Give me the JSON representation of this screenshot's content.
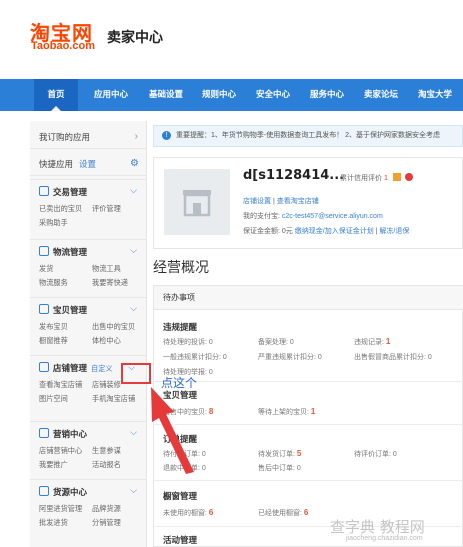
{
  "header": {
    "logo_cn": "淘宝网",
    "logo_en": "Taobao.com",
    "subtitle": "卖家中心"
  },
  "nav": {
    "items": [
      "首页",
      "应用中心",
      "基础设置",
      "规则中心",
      "安全中心",
      "服务中心",
      "卖家论坛",
      "淘宝大学"
    ],
    "active": 0
  },
  "sidebar": {
    "ordered_apps": "我订购的应用",
    "quick_apps": "快捷应用",
    "quick_settings": "设置",
    "groups": [
      {
        "title": "交易管理",
        "links": [
          "已卖出的宝贝",
          "评价管理",
          "采购助手"
        ]
      },
      {
        "title": "物流管理",
        "links": [
          "发货",
          "物流工具",
          "物流服务",
          "我要寄快递"
        ]
      },
      {
        "title": "宝贝管理",
        "links": [
          "发布宝贝",
          "出售中的宝贝",
          "橱窗推荐",
          "体检中心"
        ]
      },
      {
        "title": "店铺管理",
        "custom": "自定义",
        "links": [
          "查看淘宝店铺",
          "店铺装修",
          "图片空间",
          "手机淘宝店铺"
        ]
      },
      {
        "title": "营销中心",
        "links": [
          "店铺营销中心",
          "我要推广",
          "生意参谋",
          "活动报名"
        ]
      },
      {
        "title": "货源中心",
        "links": [
          "阿里进货管理",
          "品牌货源",
          "批发进货",
          "分销管理"
        ]
      }
    ]
  },
  "annotation": "点这个",
  "notice": "重要提醒：1、年货节购物季-使用数据查询工具发布！ 2、基于保护网家数据安全考虑",
  "shop": {
    "name": "d[s1128414...",
    "credit_label": "累计信用评价",
    "credit_value": "1",
    "link_settings": "店铺设置",
    "link_view": "查看淘宝店铺",
    "alipay_label": "我的支付宝:",
    "alipay_value": "c2c-test457@service.aliyun.com",
    "deposit_label": "保证金金额: 0元",
    "deposit_links": "缴纳现金/加入保证金计划",
    "deposit_more": "解冻/退保"
  },
  "overview_title": "经营概况",
  "todo": {
    "header": "待办事项",
    "sections": [
      {
        "title": "违规提醒",
        "cells": [
          {
            "label": "待处理的投诉:",
            "value": "0"
          },
          {
            "label": "备案处理:",
            "value": "0"
          },
          {
            "label": "违规记录:",
            "value": "1"
          },
          {
            "label": "一般违规累计扣分:",
            "value": "0"
          },
          {
            "label": "严重违规累计扣分:",
            "value": "0"
          },
          {
            "label": "出售假冒商品累计扣分:",
            "value": "0"
          },
          {
            "label": "待处理的举报:",
            "value": "0"
          }
        ]
      },
      {
        "title": "宝贝管理",
        "cells": [
          {
            "label": "出售中的宝贝:",
            "value": "8"
          },
          {
            "label": "等待上架的宝贝:",
            "value": "1"
          }
        ]
      },
      {
        "title": "订单提醒",
        "cells": [
          {
            "label": "待付款订单:",
            "value": "0"
          },
          {
            "label": "待发货订单:",
            "value": "5"
          },
          {
            "label": "待评价订单:",
            "value": "0"
          },
          {
            "label": "退款中订单:",
            "value": "0"
          },
          {
            "label": "售后中订单:",
            "value": "0"
          }
        ]
      },
      {
        "title": "橱窗管理",
        "cells": [
          {
            "label": "未使用的橱窗:",
            "value": "6"
          },
          {
            "label": "已经使用橱窗:",
            "value": "6"
          }
        ]
      },
      {
        "title": "活动管理",
        "cells": []
      }
    ]
  },
  "watermark": {
    "main": "查字典 教程网",
    "sub": "jiaocheng.chazidian.com"
  },
  "colors": {
    "brand": "#ff4400",
    "nav": "#2b7fd6",
    "accent": "#3a7fd5",
    "highlight": "#e63a3a"
  }
}
